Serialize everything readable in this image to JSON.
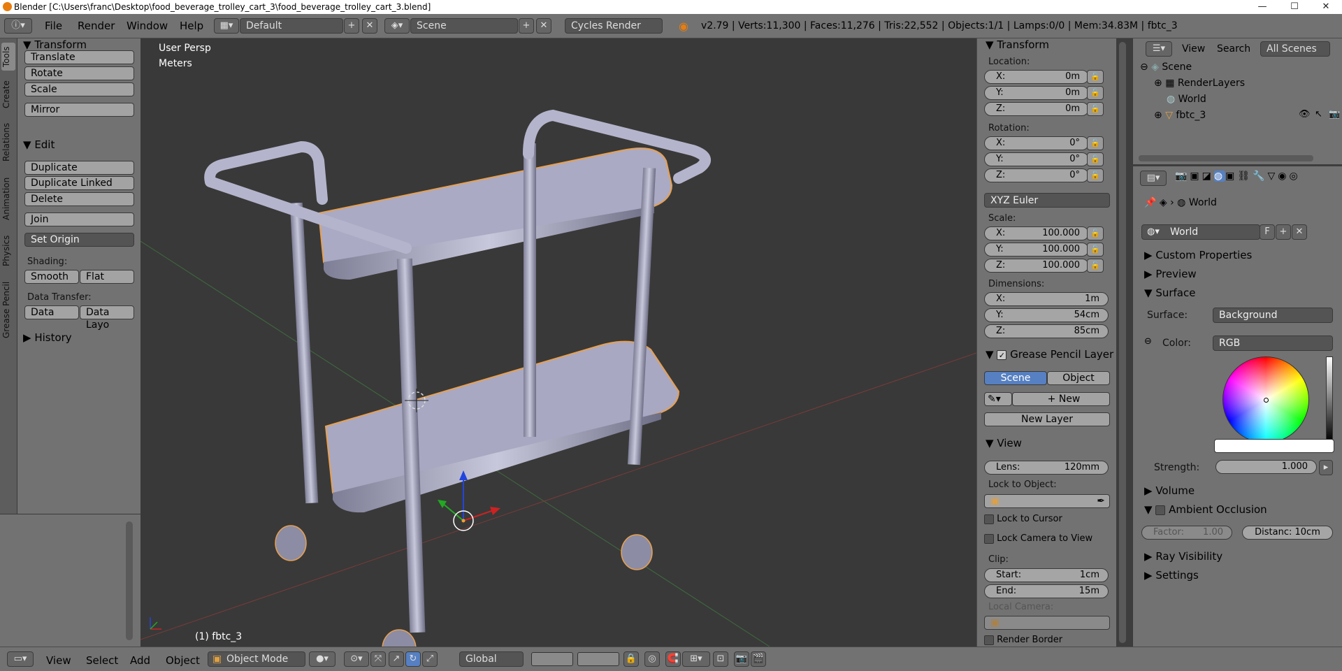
{
  "window": {
    "title": "Blender [C:\\Users\\franc\\Desktop\\food_beverage_trolley_cart_3\\food_beverage_trolley_cart_3.blend]",
    "min": "—",
    "max": "☐",
    "close": "✕"
  },
  "topbar": {
    "menus": [
      "File",
      "Render",
      "Window",
      "Help"
    ],
    "layout": "Default",
    "scene": "Scene",
    "engine": "Cycles Render",
    "stats": "v2.79 | Verts:11,300 | Faces:11,276 | Tris:22,552 | Objects:1/1 | Lamps:0/0 | Mem:34.83M | fbtc_3"
  },
  "tabs": [
    "Tools",
    "Create",
    "Relations",
    "Animation",
    "Physics",
    "Grease Pencil"
  ],
  "toolshelf": {
    "transform_title": "Transform",
    "translate": "Translate",
    "rotate": "Rotate",
    "scale": "Scale",
    "mirror": "Mirror",
    "edit_title": "Edit",
    "duplicate": "Duplicate",
    "duplicate_linked": "Duplicate Linked",
    "delete": "Delete",
    "join": "Join",
    "set_origin": "Set Origin",
    "shading_label": "Shading:",
    "smooth": "Smooth",
    "flat": "Flat",
    "data_transfer_label": "Data Transfer:",
    "data": "Data",
    "data_layout": "Data Layo",
    "history_title": "History"
  },
  "viewport": {
    "view_name": "User Persp",
    "units": "Meters",
    "object_label": "(1) fbtc_3"
  },
  "npanel": {
    "transform_title": "Transform",
    "location_label": "Location:",
    "location": [
      {
        "k": "X:",
        "v": "0m"
      },
      {
        "k": "Y:",
        "v": "0m"
      },
      {
        "k": "Z:",
        "v": "0m"
      }
    ],
    "rotation_label": "Rotation:",
    "rotation": [
      {
        "k": "X:",
        "v": "0°"
      },
      {
        "k": "Y:",
        "v": "0°"
      },
      {
        "k": "Z:",
        "v": "0°"
      }
    ],
    "rotation_mode": "XYZ Euler",
    "scale_label": "Scale:",
    "scale": [
      {
        "k": "X:",
        "v": "100.000"
      },
      {
        "k": "Y:",
        "v": "100.000"
      },
      {
        "k": "Z:",
        "v": "100.000"
      }
    ],
    "dimensions_label": "Dimensions:",
    "dimensions": [
      {
        "k": "X:",
        "v": "1m"
      },
      {
        "k": "Y:",
        "v": "54cm"
      },
      {
        "k": "Z:",
        "v": "85cm"
      }
    ],
    "grease_title": "Grease Pencil Layer",
    "scene_btn": "Scene",
    "object_btn": "Object",
    "new_btn": "New",
    "new_layer_btn": "New Layer",
    "view_title": "View",
    "lens_k": "Lens:",
    "lens_v": "120mm",
    "lock_object_label": "Lock to Object:",
    "lock_cursor": "Lock to Cursor",
    "lock_camera": "Lock Camera to View",
    "clip_label": "Clip:",
    "clip_start_k": "Start:",
    "clip_start_v": "1cm",
    "clip_end_k": "End:",
    "clip_end_v": "15m",
    "local_camera_label": "Local Camera:",
    "render_border": "Render Border"
  },
  "outliner": {
    "view": "View",
    "search": "Search",
    "all_scenes": "All Scenes",
    "items": [
      "Scene",
      "RenderLayers",
      "World",
      "fbtc_3"
    ]
  },
  "props": {
    "breadcrumb": "World",
    "datablock": "World",
    "fake_user": "F",
    "custom_properties": "Custom Properties",
    "preview": "Preview",
    "surface": "Surface",
    "surface_label": "Surface:",
    "surface_value": "Background",
    "color_label": "Color:",
    "color_value": "RGB",
    "strength_k": "Strength:",
    "strength_v": "1.000",
    "volume": "Volume",
    "ambient_occlusion": "Ambient Occlusion",
    "factor_k": "Factor:",
    "factor_v": "1.00",
    "distance": "Distanc: 10cm",
    "ray_visibility": "Ray Visibility",
    "settings": "Settings"
  },
  "bottombar": {
    "menus": [
      "View",
      "Select",
      "Add",
      "Object"
    ],
    "mode": "Object Mode",
    "orientation": "Global"
  },
  "colors": {
    "ui_grey": "#727272",
    "viewport_bg": "#393939",
    "accent_blue": "#5680c2",
    "selection_orange": "#f0a030"
  }
}
